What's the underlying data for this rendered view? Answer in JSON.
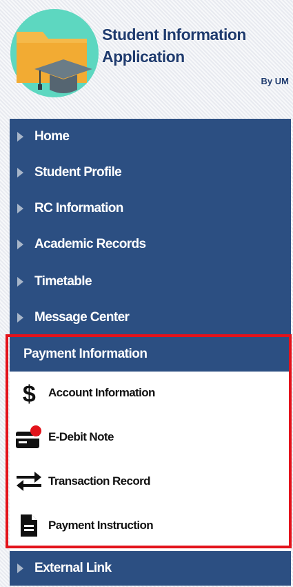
{
  "header": {
    "title": "Student Information Application",
    "subtitle": "By UM",
    "logo_icon": "folder-graduation-cap-icon"
  },
  "menu": {
    "items": [
      {
        "label": "Home",
        "icon": "caret-right-icon"
      },
      {
        "label": "Student Profile",
        "icon": "caret-right-icon"
      },
      {
        "label": "RC Information",
        "icon": "caret-right-icon"
      },
      {
        "label": "Academic Records",
        "icon": "caret-right-icon"
      },
      {
        "label": "Timetable",
        "icon": "caret-right-icon"
      },
      {
        "label": "Message Center",
        "icon": "caret-right-icon"
      }
    ],
    "section": {
      "label": "Payment Information",
      "items": [
        {
          "label": "Account Information",
          "icon": "dollar-icon"
        },
        {
          "label": "E-Debit Note",
          "icon": "credit-card-alert-icon"
        },
        {
          "label": "Transaction Record",
          "icon": "swap-arrows-icon"
        },
        {
          "label": "Payment Instruction",
          "icon": "document-icon"
        }
      ]
    },
    "footer_item": {
      "label": "External Link",
      "icon": "caret-right-icon"
    }
  },
  "colors": {
    "menu_bg": "#2c4f82",
    "title_text": "#1f3b6e",
    "highlight_border": "#e3131b",
    "alert_dot": "#e3131b"
  }
}
